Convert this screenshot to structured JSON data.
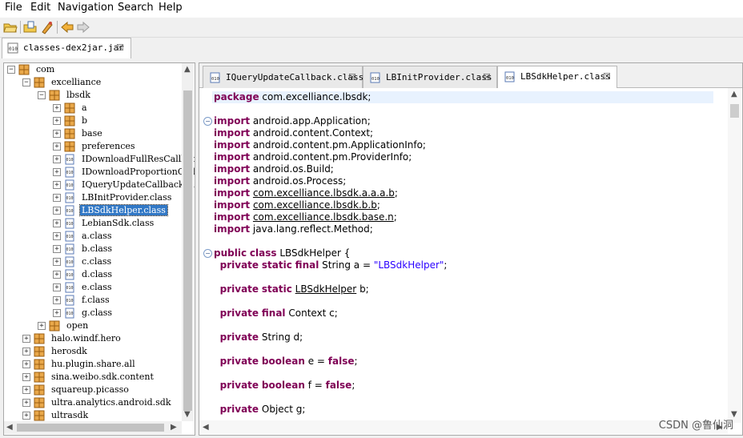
{
  "menubar": {
    "items": [
      "File",
      "Edit",
      "Navigation",
      "Search",
      "Help"
    ]
  },
  "toolbar": {
    "buttons": [
      "open-folder-icon",
      "open-file-icon",
      "sync-icon",
      "back-icon",
      "forward-icon"
    ]
  },
  "outer_tab": {
    "label": "classes-dex2jar.jar"
  },
  "tree": {
    "rows": [
      {
        "label": "com",
        "level": 0,
        "type": "package",
        "exp": "−"
      },
      {
        "label": "excelliance",
        "level": 1,
        "type": "package",
        "exp": "−"
      },
      {
        "label": "lbsdk",
        "level": 2,
        "type": "package",
        "exp": "−"
      },
      {
        "label": "a",
        "level": 3,
        "type": "package",
        "exp": "+"
      },
      {
        "label": "b",
        "level": 3,
        "type": "package",
        "exp": "+"
      },
      {
        "label": "base",
        "level": 3,
        "type": "package",
        "exp": "+"
      },
      {
        "label": "preferences",
        "level": 3,
        "type": "package",
        "exp": "+"
      },
      {
        "label": "IDownloadFullResCallback.class",
        "level": 3,
        "type": "class",
        "exp": "+"
      },
      {
        "label": "IDownloadProportionCallback.class",
        "level": 3,
        "type": "class",
        "exp": "+"
      },
      {
        "label": "IQueryUpdateCallback.class",
        "level": 3,
        "type": "class",
        "exp": "+"
      },
      {
        "label": "LBInitProvider.class",
        "level": 3,
        "type": "class",
        "exp": "+"
      },
      {
        "label": "LBSdkHelper.class",
        "level": 3,
        "type": "class",
        "exp": "+",
        "selected": true
      },
      {
        "label": "LebianSdk.class",
        "level": 3,
        "type": "class",
        "exp": "+"
      },
      {
        "label": "a.class",
        "level": 3,
        "type": "class",
        "exp": "+"
      },
      {
        "label": "b.class",
        "level": 3,
        "type": "class",
        "exp": "+"
      },
      {
        "label": "c.class",
        "level": 3,
        "type": "class",
        "exp": "+"
      },
      {
        "label": "d.class",
        "level": 3,
        "type": "class",
        "exp": "+"
      },
      {
        "label": "e.class",
        "level": 3,
        "type": "class",
        "exp": "+"
      },
      {
        "label": "f.class",
        "level": 3,
        "type": "class",
        "exp": "+"
      },
      {
        "label": "g.class",
        "level": 3,
        "type": "class",
        "exp": "+"
      },
      {
        "label": "open",
        "level": 2,
        "type": "package",
        "exp": "+"
      },
      {
        "label": "halo.windf.hero",
        "level": 1,
        "type": "package",
        "exp": "+"
      },
      {
        "label": "herosdk",
        "level": 1,
        "type": "package",
        "exp": "+"
      },
      {
        "label": "hu.plugin.share.all",
        "level": 1,
        "type": "package",
        "exp": "+"
      },
      {
        "label": "sina.weibo.sdk.content",
        "level": 1,
        "type": "package",
        "exp": "+"
      },
      {
        "label": "squareup.picasso",
        "level": 1,
        "type": "package",
        "exp": "+"
      },
      {
        "label": "ultra.analytics.android.sdk",
        "level": 1,
        "type": "package",
        "exp": "+"
      },
      {
        "label": "ultrasdk",
        "level": 1,
        "type": "package",
        "exp": "+"
      }
    ]
  },
  "editor_tabs": [
    {
      "label": "IQueryUpdateCallback.class",
      "active": false
    },
    {
      "label": "LBInitProvider.class",
      "active": false
    },
    {
      "label": "LBSdkHelper.class",
      "active": true
    }
  ],
  "code": {
    "lines": [
      {
        "fold": false,
        "parts": [
          {
            "t": "package",
            "c": "kw"
          },
          {
            "t": " com.excelliance.lbsdk;"
          }
        ]
      },
      {
        "fold": false,
        "parts": []
      },
      {
        "fold": true,
        "parts": [
          {
            "t": "import",
            "c": "kw"
          },
          {
            "t": " android.app.Application;"
          }
        ]
      },
      {
        "fold": false,
        "parts": [
          {
            "t": "import",
            "c": "kw"
          },
          {
            "t": " android.content.Context;"
          }
        ]
      },
      {
        "fold": false,
        "parts": [
          {
            "t": "import",
            "c": "kw"
          },
          {
            "t": " android.content.pm.ApplicationInfo;"
          }
        ]
      },
      {
        "fold": false,
        "parts": [
          {
            "t": "import",
            "c": "kw"
          },
          {
            "t": " android.content.pm.ProviderInfo;"
          }
        ]
      },
      {
        "fold": false,
        "parts": [
          {
            "t": "import",
            "c": "kw"
          },
          {
            "t": " android.os.Build;"
          }
        ]
      },
      {
        "fold": false,
        "parts": [
          {
            "t": "import",
            "c": "kw"
          },
          {
            "t": " android.os.Process;"
          }
        ]
      },
      {
        "fold": false,
        "parts": [
          {
            "t": "import",
            "c": "kw"
          },
          {
            "t": " "
          },
          {
            "t": "com.excelliance.lbsdk.a.a.a.b",
            "c": "ul"
          },
          {
            "t": ";"
          }
        ]
      },
      {
        "fold": false,
        "parts": [
          {
            "t": "import",
            "c": "kw"
          },
          {
            "t": " "
          },
          {
            "t": "com.excelliance.lbsdk.b.b",
            "c": "ul"
          },
          {
            "t": ";"
          }
        ]
      },
      {
        "fold": false,
        "parts": [
          {
            "t": "import",
            "c": "kw"
          },
          {
            "t": " "
          },
          {
            "t": "com.excelliance.lbsdk.base.n",
            "c": "ul"
          },
          {
            "t": ";"
          }
        ]
      },
      {
        "fold": false,
        "parts": [
          {
            "t": "import",
            "c": "kw"
          },
          {
            "t": " java.lang.reflect.Method;"
          }
        ]
      },
      {
        "fold": false,
        "parts": []
      },
      {
        "fold": true,
        "parts": [
          {
            "t": "public",
            "c": "kw"
          },
          {
            "t": " "
          },
          {
            "t": "class",
            "c": "kw"
          },
          {
            "t": " LBSdkHelper {"
          }
        ]
      },
      {
        "fold": false,
        "parts": [
          {
            "t": "  "
          },
          {
            "t": "private",
            "c": "kw"
          },
          {
            "t": " "
          },
          {
            "t": "static",
            "c": "kw"
          },
          {
            "t": " "
          },
          {
            "t": "final",
            "c": "kw"
          },
          {
            "t": " String a = "
          },
          {
            "t": "\"LBSdkHelper\"",
            "c": "str"
          },
          {
            "t": ";"
          }
        ]
      },
      {
        "fold": false,
        "parts": []
      },
      {
        "fold": false,
        "parts": [
          {
            "t": "  "
          },
          {
            "t": "private",
            "c": "kw"
          },
          {
            "t": " "
          },
          {
            "t": "static",
            "c": "kw"
          },
          {
            "t": " "
          },
          {
            "t": "LBSdkHelper",
            "c": "ul"
          },
          {
            "t": " b;"
          }
        ]
      },
      {
        "fold": false,
        "parts": []
      },
      {
        "fold": false,
        "parts": [
          {
            "t": "  "
          },
          {
            "t": "private",
            "c": "kw"
          },
          {
            "t": " "
          },
          {
            "t": "final",
            "c": "kw"
          },
          {
            "t": " Context c;"
          }
        ]
      },
      {
        "fold": false,
        "parts": []
      },
      {
        "fold": false,
        "parts": [
          {
            "t": "  "
          },
          {
            "t": "private",
            "c": "kw"
          },
          {
            "t": " String d;"
          }
        ]
      },
      {
        "fold": false,
        "parts": []
      },
      {
        "fold": false,
        "parts": [
          {
            "t": "  "
          },
          {
            "t": "private",
            "c": "kw"
          },
          {
            "t": " "
          },
          {
            "t": "boolean",
            "c": "kw"
          },
          {
            "t": " e = "
          },
          {
            "t": "false",
            "c": "kw"
          },
          {
            "t": ";"
          }
        ]
      },
      {
        "fold": false,
        "parts": []
      },
      {
        "fold": false,
        "parts": [
          {
            "t": "  "
          },
          {
            "t": "private",
            "c": "kw"
          },
          {
            "t": " "
          },
          {
            "t": "boolean",
            "c": "kw"
          },
          {
            "t": " f = "
          },
          {
            "t": "false",
            "c": "kw"
          },
          {
            "t": ";"
          }
        ]
      },
      {
        "fold": false,
        "parts": []
      },
      {
        "fold": false,
        "parts": [
          {
            "t": "  "
          },
          {
            "t": "private",
            "c": "kw"
          },
          {
            "t": " Object g;"
          }
        ]
      }
    ]
  },
  "watermark": "CSDN @鲁仙洞",
  "colors": {
    "selection": "#3178c6",
    "keyword": "#7f0055",
    "string": "#2a00ff",
    "current_line": "#e8f2fe"
  }
}
